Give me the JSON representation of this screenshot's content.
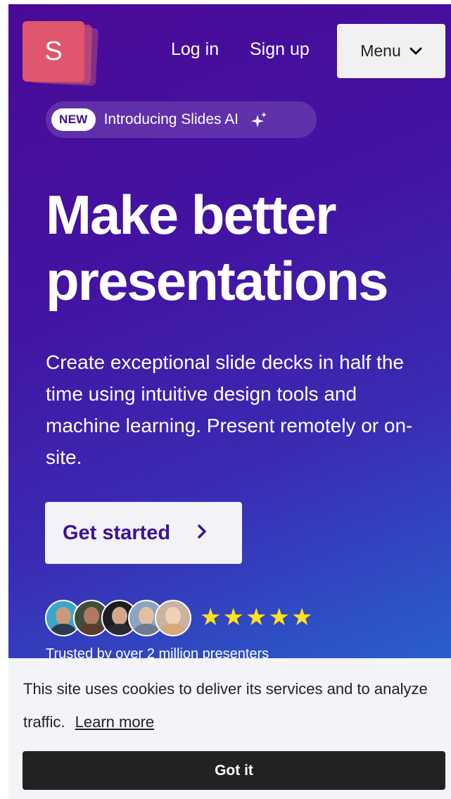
{
  "brand": {
    "logo_letter": "S"
  },
  "nav": {
    "login": "Log in",
    "signup": "Sign up",
    "menu": "Menu",
    "menu_icon": "chevron-down-icon"
  },
  "badge": {
    "tag": "NEW",
    "text": "Introducing Slides AI",
    "icon": "sparkle-icon"
  },
  "hero": {
    "headline_line1": "Make better",
    "headline_line2": "presentations",
    "subtext": "Create exceptional slide decks in half the time using intuitive design tools and machine learning. Present remotely or on-site.",
    "cta": "Get started",
    "cta_icon": "chevron-right-icon"
  },
  "social_proof": {
    "stars": "★★★★★",
    "rating": 5,
    "trusted": "Trusted by over 2 million presenters"
  },
  "cookie": {
    "message": "This site uses cookies to deliver its services and to analyze traffic.",
    "learn_more": "Learn more",
    "accept": "Got it"
  },
  "colors": {
    "gradient_top": "#4a0a96",
    "gradient_bottom": "#2477d6",
    "logo": "#e0566e",
    "cta_text": "#3d1290",
    "stars": "#ffe21a",
    "cookie_button": "#222222"
  }
}
